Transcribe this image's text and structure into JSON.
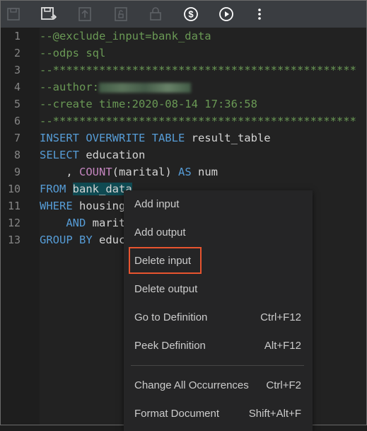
{
  "toolbar": {
    "buttons": [
      {
        "name": "save-disabled-icon"
      },
      {
        "name": "save-as-icon"
      },
      {
        "name": "upload-icon"
      },
      {
        "name": "unlock-file-icon"
      },
      {
        "name": "lock-icon"
      },
      {
        "name": "cost-estimate-icon"
      },
      {
        "name": "run-icon"
      },
      {
        "name": "more-icon"
      }
    ]
  },
  "editor": {
    "line_numbers": [
      "1",
      "2",
      "3",
      "4",
      "5",
      "6",
      "7",
      "8",
      "9",
      "10",
      "11",
      "12",
      "13"
    ],
    "lines": {
      "l1": "--@exclude_input=bank_data",
      "l2": "--odps sql",
      "l3": "--**********************************************",
      "l4_prefix": "--author:",
      "l5": "--create time:2020-08-14 17:36:58",
      "l6": "--**********************************************",
      "l7_kw": "INSERT OVERWRITE TABLE",
      "l7_rest": " result_table",
      "l8_kw": "SELECT",
      "l8_rest": " education",
      "l9_pre": "    , ",
      "l9_fn": "COUNT",
      "l9_mid": "(marital) ",
      "l9_kw": "AS",
      "l9_rest": " num",
      "l10_kw": "FROM",
      "l10_sp": " ",
      "l10_hl": "bank_data",
      "l11_kw": "WHERE",
      "l11_rest": " housing",
      "l12_pre": "    ",
      "l12_kw": "AND",
      "l12_rest": " marit",
      "l13_kw": "GROUP BY",
      "l13_rest": " educ"
    }
  },
  "context_menu": {
    "items": [
      {
        "label": "Add input",
        "shortcut": ""
      },
      {
        "label": "Add output",
        "shortcut": ""
      },
      {
        "label": "Delete input",
        "shortcut": ""
      },
      {
        "label": "Delete output",
        "shortcut": ""
      },
      {
        "label": "Go to Definition",
        "shortcut": "Ctrl+F12"
      },
      {
        "label": "Peek Definition",
        "shortcut": "Alt+F12"
      },
      {
        "label": "Change All Occurrences",
        "shortcut": "Ctrl+F2"
      },
      {
        "label": "Format Document",
        "shortcut": "Shift+Alt+F"
      }
    ]
  },
  "colors": {
    "comment": "#6a9955",
    "keyword": "#569cd6",
    "function": "#c586c0",
    "highlight_box": "#e8542f"
  }
}
